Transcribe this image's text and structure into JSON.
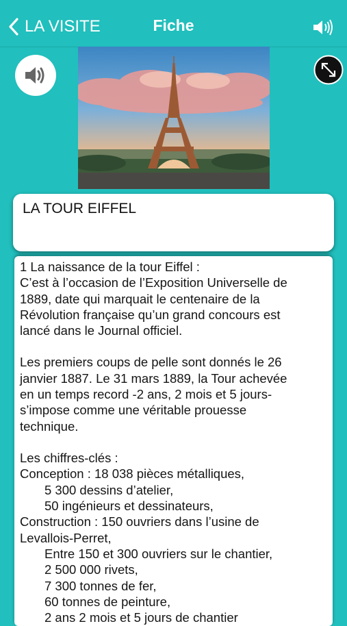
{
  "nav": {
    "back_label": "LA VISITE",
    "title": "Fiche"
  },
  "colors": {
    "background": "#21bfbd",
    "accent_text": "#ffffff"
  },
  "icons": {
    "back": "chevron-left-icon",
    "speaker_top": "speaker-icon",
    "audio": "speaker-icon",
    "expand": "expand-icon"
  },
  "card": {
    "title": "LA TOUR EIFFEL"
  },
  "text": [
    "1 La naissance de la tour Eiffel :",
    "C’est à l’occasion de l’Exposition Universelle de",
    "1889, date qui marquait le centenaire de la",
    "Révolution française qu’un grand concours est",
    "lancé dans le Journal officiel.",
    "Les premiers coups de pelle sont donnés le 26",
    "janvier 1887. Le 31 mars 1889, la Tour achevée",
    "en un temps record -2 ans, 2 mois et 5 jours-",
    "s’impose comme une véritable prouesse",
    "technique.",
    "Les chiffres-clés :",
    "Conception :     18 038 pièces métalliques,",
    "5 300 dessins d’atelier,",
    "50 ingénieurs et dessinateurs,",
    "Construction :   150 ouvriers dans l’usine de",
    "Levallois-Perret,",
    "Entre 150 et 300 ouvriers sur le chantier,",
    "2 500 000 rivets,",
    "7 300 tonnes de fer,",
    "60 tonnes de peinture,",
    "2 ans 2 mois et 5 jours de chantier"
  ]
}
